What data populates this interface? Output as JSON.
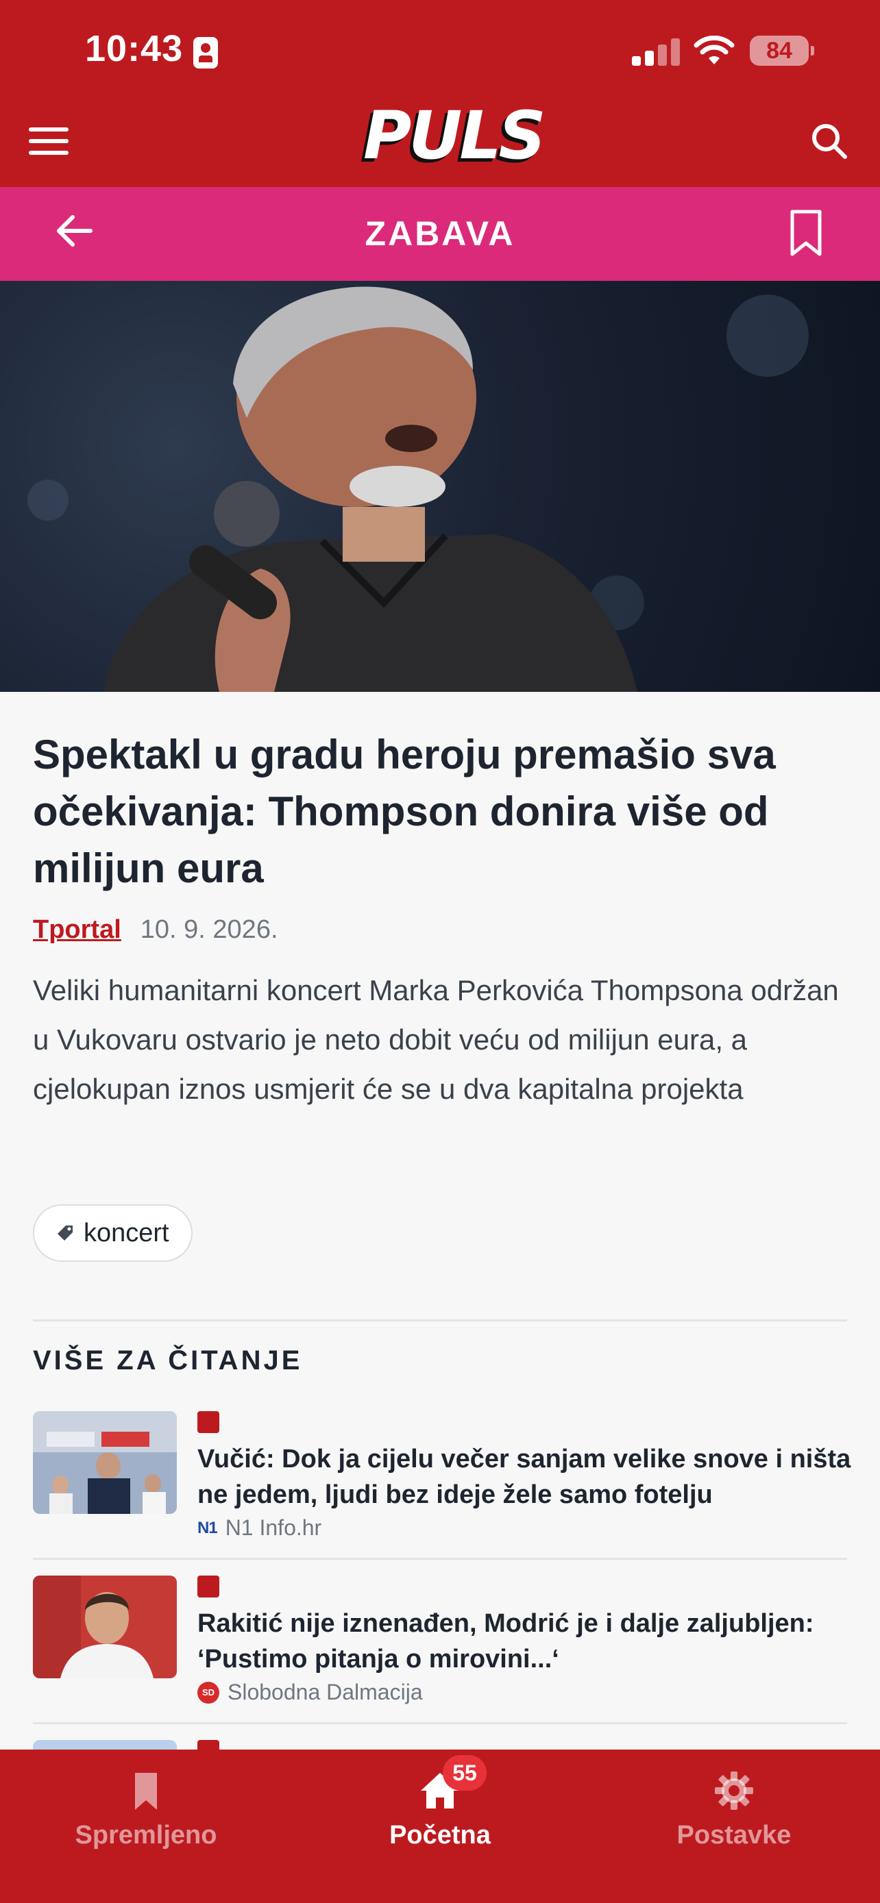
{
  "status_bar": {
    "time": "10:43",
    "battery": "84"
  },
  "header": {
    "logo": "PULS"
  },
  "category_bar": {
    "title": "ZABAVA"
  },
  "article": {
    "title": "Spektakl u gradu heroju premašio sva očekivanja: Thompson donira više od milijun eura",
    "source": "Tportal",
    "date": "10. 9. 2026.",
    "summary": "Veliki humanitarni koncert Marka Perkovića Thompsona održan u Vukovaru ostvario je neto dobit veću od milijun eura, a cjelokupan iznos usmjerit će se u dva kapitalna projekta",
    "tag": "koncert"
  },
  "related": {
    "section_title": "VIŠE ZA ČITANJE",
    "items": [
      {
        "title": "Vučić: Dok ja cijelu večer sanjam velike snove i ništa ne jedem, ljudi bez ideje žele samo fotelju",
        "source": "N1 Info.hr",
        "source_logo": "N1"
      },
      {
        "title": "Rakitić nije iznenađen, Modrić je i dalje zaljubljen: ‘Pustimo pitanja o mirovini...‘",
        "source": "Slobodna Dalmacija",
        "source_logo": "SD"
      }
    ]
  },
  "bottom_nav": {
    "items": [
      {
        "label": "Spremljeno",
        "icon": "bookmark-icon"
      },
      {
        "label": "Početna",
        "icon": "home-icon",
        "badge": "55"
      },
      {
        "label": "Postavke",
        "icon": "gear-icon"
      }
    ]
  },
  "colors": {
    "brand_red": "#bd1a1f",
    "category_pink": "#dc2a7a",
    "badge_red": "#e8323a"
  }
}
